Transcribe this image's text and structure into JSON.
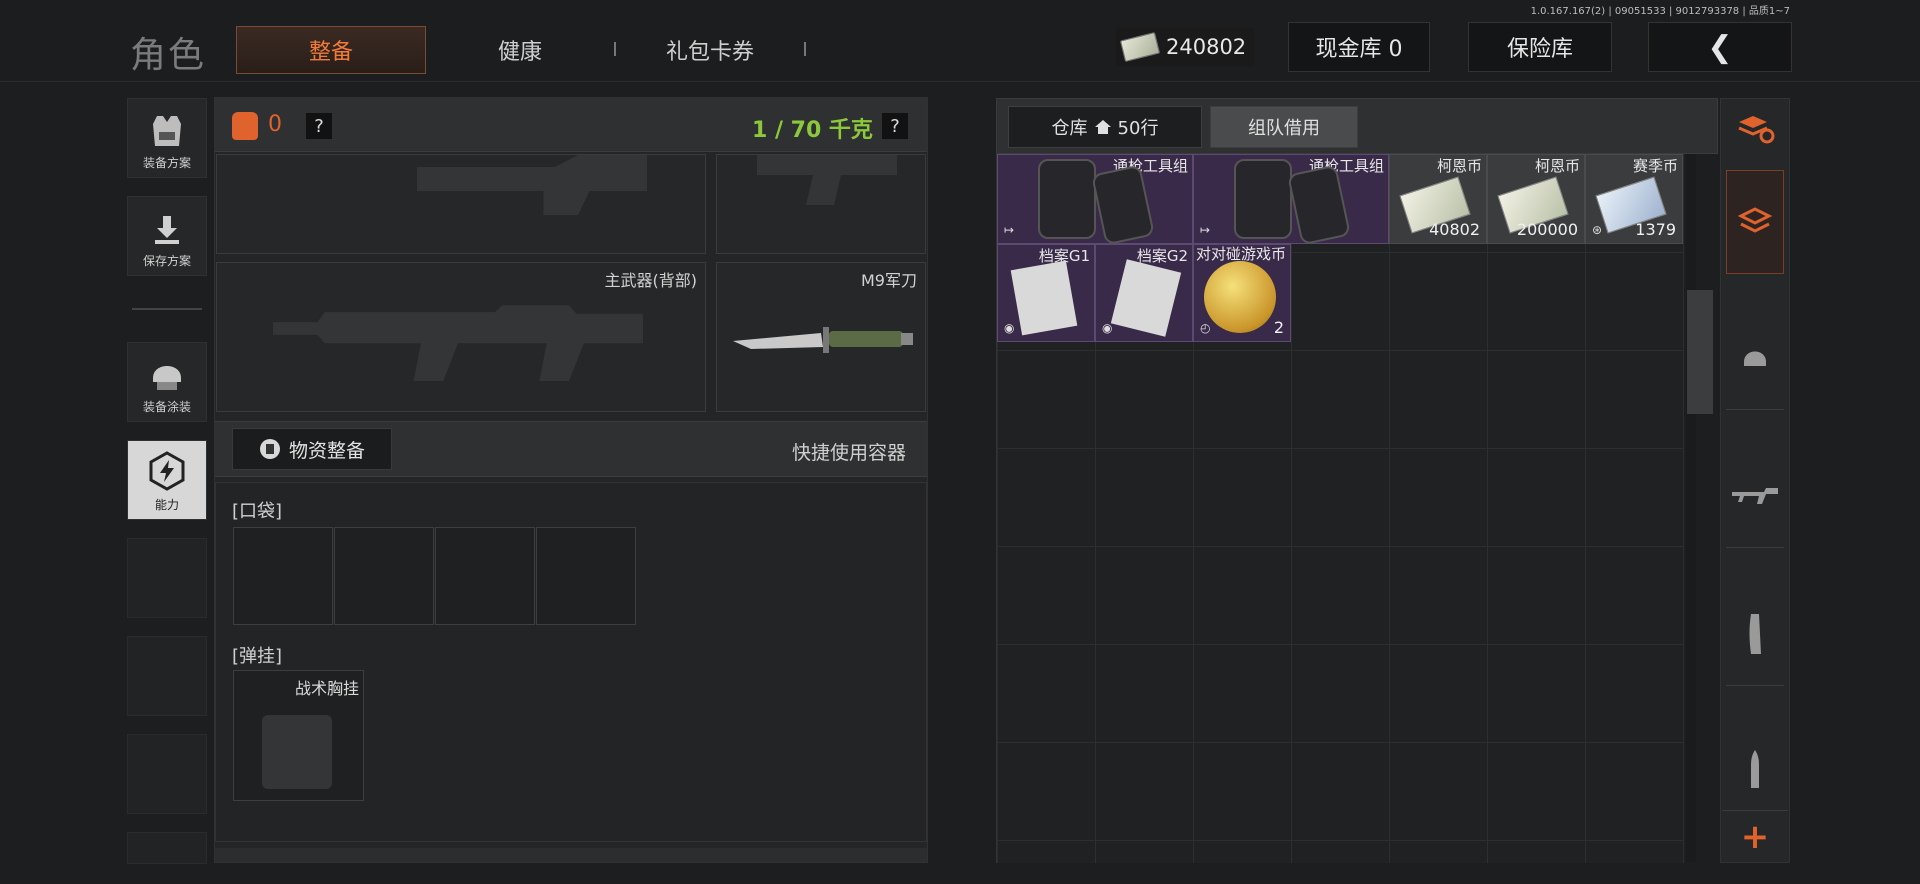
{
  "version_text": "1.0.167.167(2) | 09051533 | 9012793378 | 品质1~7",
  "header": {
    "title": "角色",
    "tabs": [
      "整备",
      "健康",
      "礼包卡券"
    ],
    "currency": "240802",
    "cash_vault": "现金库 0",
    "safe": "保险库",
    "back_glyph": "❮"
  },
  "sidebar": {
    "items": [
      "装备方案",
      "保存方案",
      "装备涂装",
      "能力"
    ]
  },
  "equipment": {
    "bag_count": "0",
    "help": "?",
    "weight": "1 / 70 千克",
    "primary_back": "主武器(背部)",
    "knife": "M9军刀",
    "supply_button": "物资整备",
    "quick_container": "快捷使用容器",
    "pocket_label": "[口袋]",
    "rig_label": "[弹挂]",
    "rig_item": "战术胸挂"
  },
  "warehouse": {
    "tab_label": "仓库",
    "tab_rows": "50行",
    "team_borrow": "组队借用",
    "items": [
      {
        "name": "通枪工具组",
        "qty": ""
      },
      {
        "name": "通枪工具组",
        "qty": ""
      },
      {
        "name": "柯恩币",
        "qty": "40802"
      },
      {
        "name": "柯恩币",
        "qty": "200000"
      },
      {
        "name": "赛季币",
        "qty": "1379"
      },
      {
        "name": "档案G1",
        "qty": ""
      },
      {
        "name": "档案G2",
        "qty": ""
      },
      {
        "name": "对对碰游戏币",
        "qty": "2"
      }
    ]
  },
  "rail": {
    "add": "+"
  }
}
